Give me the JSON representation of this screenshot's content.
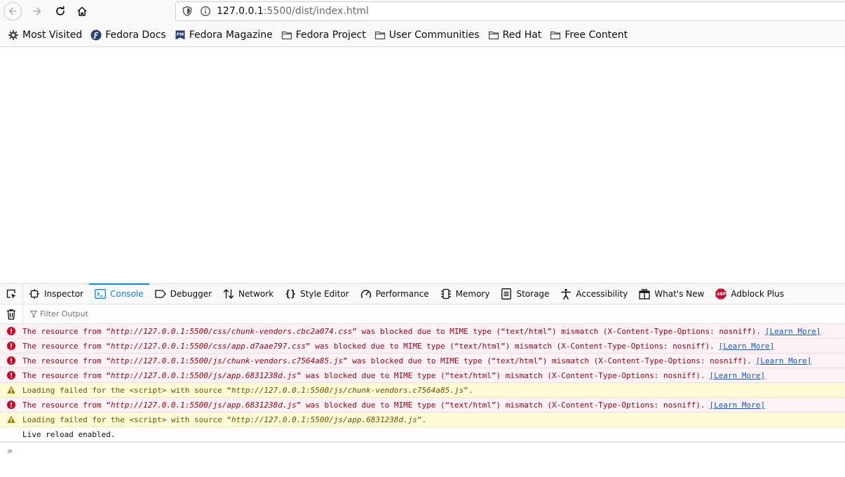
{
  "navbar": {
    "url_host": "127.0.0.1",
    "url_rest": ":5500/dist/index.html"
  },
  "bookmarks": [
    {
      "label": "Most Visited",
      "icon": "gear-icon"
    },
    {
      "label": "Fedora Docs",
      "icon": "fedora-icon"
    },
    {
      "label": "Fedora Magazine",
      "icon": "fedora-magazine-icon"
    },
    {
      "label": "Fedora Project",
      "icon": "folder-icon"
    },
    {
      "label": "User Communities",
      "icon": "folder-icon"
    },
    {
      "label": "Red Hat",
      "icon": "folder-icon"
    },
    {
      "label": "Free Content",
      "icon": "folder-icon"
    }
  ],
  "devtools": {
    "tabs": [
      {
        "label": "Inspector",
        "icon": "inspector-icon"
      },
      {
        "label": "Console",
        "icon": "console-icon",
        "selected": true
      },
      {
        "label": "Debugger",
        "icon": "debugger-icon"
      },
      {
        "label": "Network",
        "icon": "network-icon"
      },
      {
        "label": "Style Editor",
        "icon": "style-editor-icon"
      },
      {
        "label": "Performance",
        "icon": "performance-icon"
      },
      {
        "label": "Memory",
        "icon": "memory-icon"
      },
      {
        "label": "Storage",
        "icon": "storage-icon"
      },
      {
        "label": "Accessibility",
        "icon": "accessibility-icon"
      },
      {
        "label": "What's New",
        "icon": "whats-new-icon"
      },
      {
        "label": "Adblock Plus",
        "icon": "adblock-icon"
      }
    ],
    "filter_placeholder": "Filter Output",
    "learn_more": "[Learn More]",
    "messages": [
      {
        "type": "error",
        "pre": "The resource from “",
        "url": "http://127.0.0.1:5500/css/chunk-vendors.cbc2a074.css",
        "post": "” was blocked due to MIME type (“text/html”) mismatch (X-Content-Type-Options: nosniff).",
        "learn": true
      },
      {
        "type": "error",
        "pre": "The resource from “",
        "url": "http://127.0.0.1:5500/css/app.d7aae797.css",
        "post": "” was blocked due to MIME type (“text/html”) mismatch (X-Content-Type-Options: nosniff).",
        "learn": true
      },
      {
        "type": "error",
        "pre": "The resource from “",
        "url": "http://127.0.0.1:5500/js/chunk-vendors.c7564a85.js",
        "post": "” was blocked due to MIME type (“text/html”) mismatch (X-Content-Type-Options: nosniff).",
        "learn": true
      },
      {
        "type": "error",
        "pre": "The resource from “",
        "url": "http://127.0.0.1:5500/js/app.6831238d.js",
        "post": "” was blocked due to MIME type (“text/html”) mismatch (X-Content-Type-Options: nosniff).",
        "learn": true
      },
      {
        "type": "warn",
        "pre": "Loading failed for the <script> with source “",
        "url": "http://127.0.0.1:5500/js/chunk-vendors.c7564a85.js",
        "post": "”.",
        "learn": false
      },
      {
        "type": "error",
        "pre": "The resource from “",
        "url": "http://127.0.0.1:5500/js/app.6831238d.js",
        "post": "” was blocked due to MIME type (“text/html”) mismatch (X-Content-Type-Options: nosniff).",
        "learn": true
      },
      {
        "type": "warn",
        "pre": "Loading failed for the <script> with source “",
        "url": "http://127.0.0.1:5500/js/app.6831238d.js",
        "post": "”.",
        "learn": false
      },
      {
        "type": "log",
        "pre": "Live reload enabled.",
        "url": "",
        "post": "",
        "learn": false
      }
    ],
    "prompt": "»"
  },
  "colors": {
    "accent": "#0a84ff",
    "error_text": "#a4000f",
    "error_bg": "#fdf2f5",
    "warn_text": "#715100",
    "warn_bg": "#fffbd6",
    "link": "#0a56e6"
  }
}
